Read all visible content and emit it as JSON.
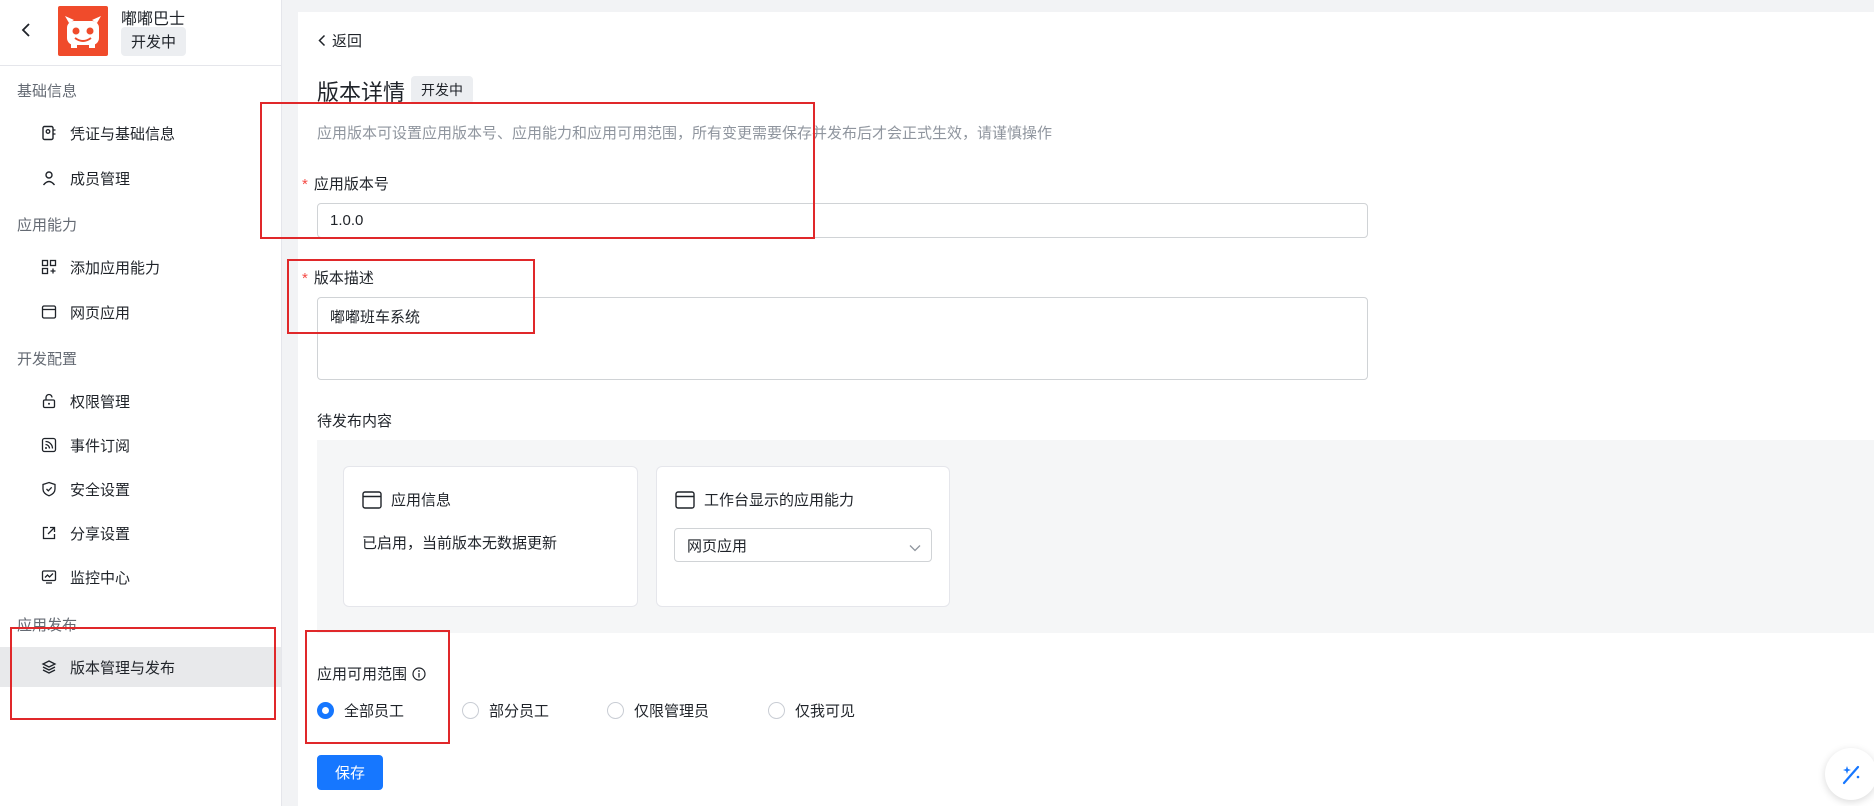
{
  "app": {
    "name": "嘟嘟巴士",
    "status": "开发中"
  },
  "sidebar": {
    "groups": [
      {
        "title": "基础信息",
        "items": [
          {
            "label": "凭证与基础信息",
            "icon": "credential-icon"
          },
          {
            "label": "成员管理",
            "icon": "user-icon"
          }
        ]
      },
      {
        "title": "应用能力",
        "items": [
          {
            "label": "添加应用能力",
            "icon": "apps-add-icon"
          },
          {
            "label": "网页应用",
            "icon": "browser-icon"
          }
        ]
      },
      {
        "title": "开发配置",
        "items": [
          {
            "label": "权限管理",
            "icon": "lock-icon"
          },
          {
            "label": "事件订阅",
            "icon": "rss-icon"
          },
          {
            "label": "安全设置",
            "icon": "shield-icon"
          },
          {
            "label": "分享设置",
            "icon": "share-icon"
          },
          {
            "label": "监控中心",
            "icon": "monitor-icon"
          }
        ]
      },
      {
        "title": "应用发布",
        "items": [
          {
            "label": "版本管理与发布",
            "icon": "layers-icon",
            "active": true
          }
        ]
      }
    ]
  },
  "main": {
    "back_label": "返回",
    "title": "版本详情",
    "title_badge": "开发中",
    "description": "应用版本可设置应用版本号、应用能力和应用可用范围，所有变更需要保存并发布后才会正式生效，请谨慎操作",
    "version": {
      "label": "应用版本号",
      "value": "1.0.0"
    },
    "version_desc": {
      "label": "版本描述",
      "value": "嘟嘟班车系统"
    },
    "pending": {
      "label": "待发布内容",
      "cards": [
        {
          "title": "应用信息",
          "text": "已启用，当前版本无数据更新"
        },
        {
          "title": "工作台显示的应用能力",
          "select_value": "网页应用"
        }
      ]
    },
    "scope": {
      "label": "应用可用范围",
      "options": [
        {
          "label": "全部员工",
          "checked": true
        },
        {
          "label": "部分员工",
          "checked": false
        },
        {
          "label": "仅限管理员",
          "checked": false
        },
        {
          "label": "仅我可见",
          "checked": false
        }
      ]
    },
    "save_label": "保存"
  },
  "colors": {
    "primary": "#1677ff",
    "annotation": "#e0282a",
    "logo": "#f04b2b"
  }
}
